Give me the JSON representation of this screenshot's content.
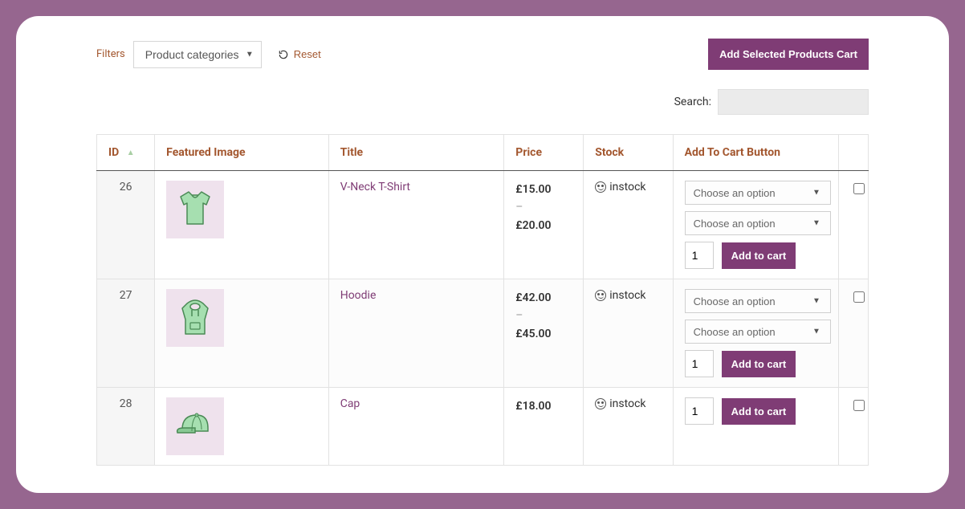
{
  "filters": {
    "label": "Filters",
    "category_selected": "Product categories",
    "reset_label": "Reset"
  },
  "buttons": {
    "add_selected": "Add Selected Products Cart",
    "add_to_cart": "Add to cart"
  },
  "search": {
    "label": "Search:",
    "value": ""
  },
  "option_placeholder": "Choose an option",
  "columns": {
    "id": "ID",
    "image": "Featured Image",
    "title": "Title",
    "price": "Price",
    "stock": "Stock",
    "atc": "Add To Cart Button"
  },
  "rows": [
    {
      "id": "26",
      "title": "V-Neck T-Shirt",
      "price_low": "£15.00",
      "price_sep": "–",
      "price_high": "£20.00",
      "stock": "instock",
      "has_options": true,
      "qty": "1",
      "image": "tshirt"
    },
    {
      "id": "27",
      "title": "Hoodie",
      "price_low": "£42.00",
      "price_sep": "–",
      "price_high": "£45.00",
      "stock": "instock",
      "has_options": true,
      "qty": "1",
      "image": "hoodie"
    },
    {
      "id": "28",
      "title": "Cap",
      "price_low": "£18.00",
      "price_sep": "",
      "price_high": "",
      "stock": "instock",
      "has_options": false,
      "qty": "1",
      "image": "cap"
    }
  ]
}
